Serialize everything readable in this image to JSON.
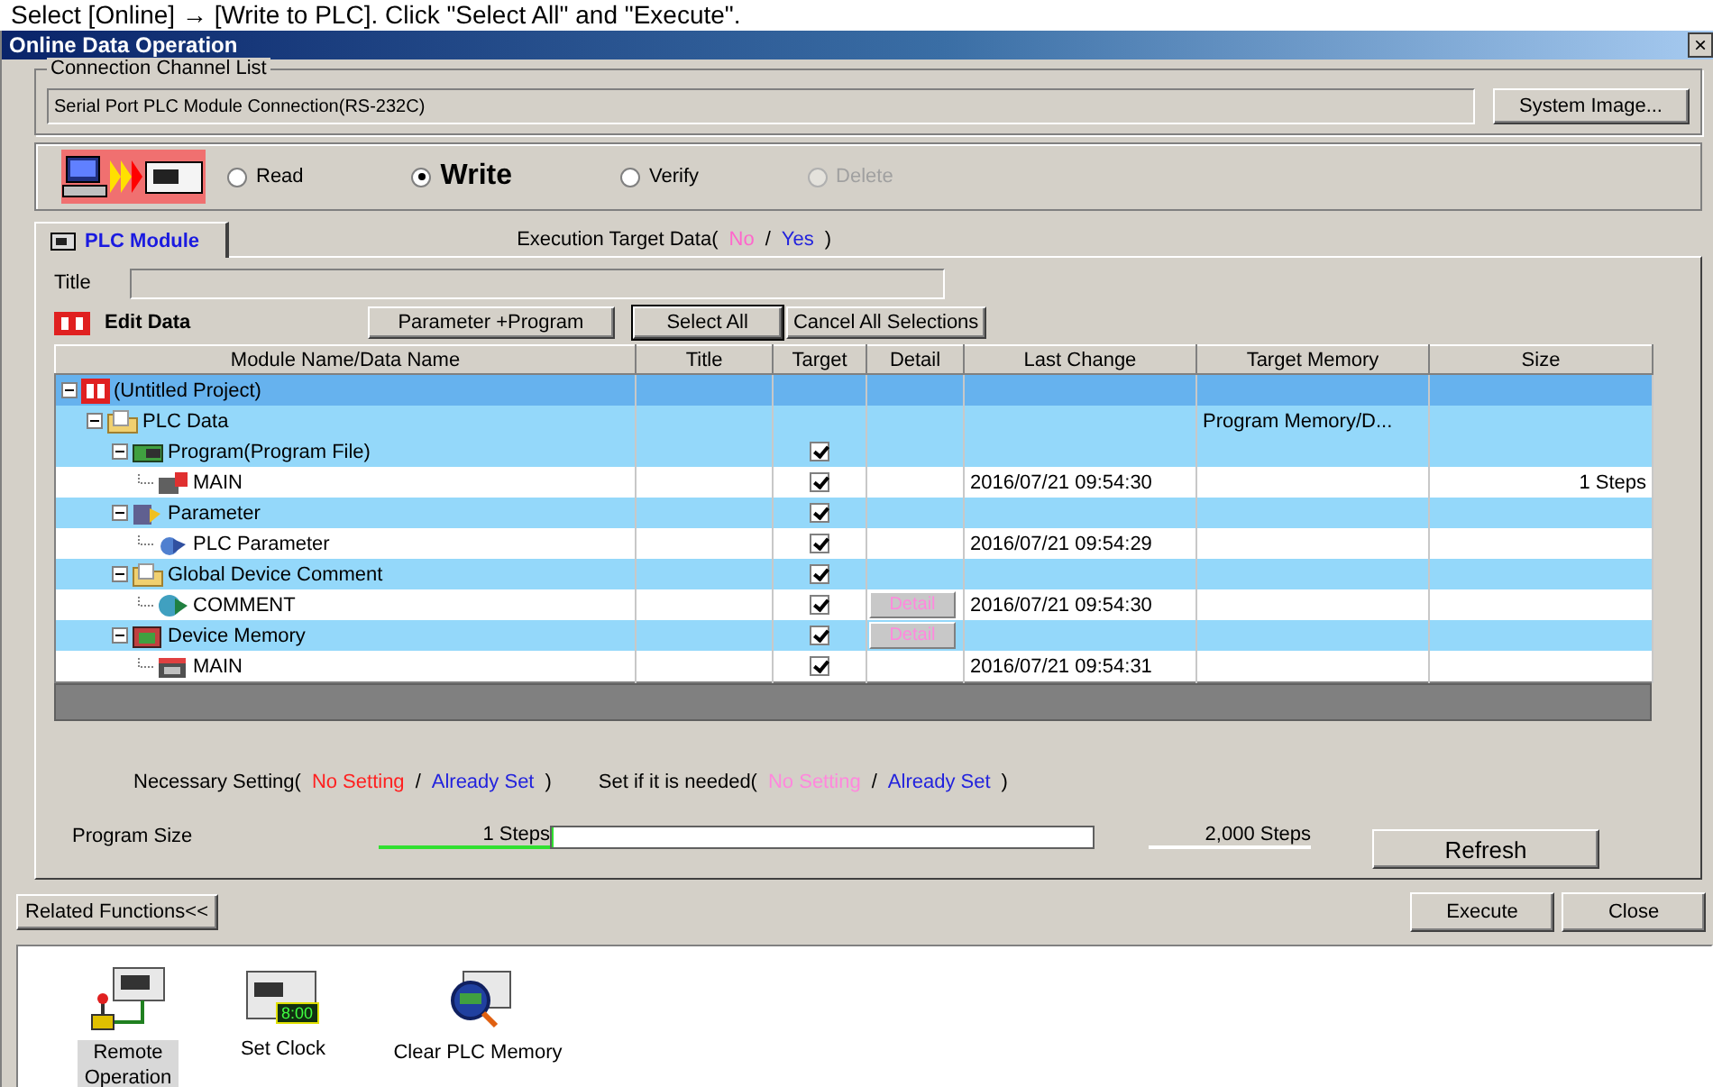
{
  "caption": "Select [Online] → [Write to PLC]. Click \"Select All\" and \"Execute\".",
  "window": {
    "title": "Online Data Operation",
    "close": "×"
  },
  "connection": {
    "legend": "Connection Channel List",
    "value": "Serial Port  PLC Module Connection(RS-232C)",
    "button": "System Image..."
  },
  "modes": [
    {
      "label": "Read",
      "selected": false,
      "disabled": false
    },
    {
      "label": "Write",
      "selected": true,
      "disabled": false
    },
    {
      "label": "Verify",
      "selected": false,
      "disabled": false
    },
    {
      "label": "Delete",
      "selected": false,
      "disabled": true
    }
  ],
  "tabs": [
    {
      "label": "PLC Module",
      "selected": true
    }
  ],
  "execution_target": [
    {
      "text": "Execution Target Data(",
      "color": "#000000"
    },
    {
      "text": "No",
      "color": "#ff66cc"
    },
    {
      "text": "/",
      "color": "#000000"
    },
    {
      "text": "Yes",
      "color": "#2222dd"
    },
    {
      "text": ")",
      "color": "#000000"
    }
  ],
  "title_field": {
    "label": "Title"
  },
  "edit_data": {
    "label": "Edit Data"
  },
  "buttons": [
    "Parameter +Program",
    "Select All",
    "Cancel All Selections"
  ],
  "table": {
    "columns": [
      "Module Name/Data Name",
      "Title",
      "Target",
      "Detail",
      "Last Change",
      "Target Memory",
      "Size"
    ],
    "rows": [
      {
        "name": "(Untitled Project)",
        "kind": "project",
        "selected": true,
        "expanded": true,
        "children": [
          {
            "name": "PLC Data",
            "kind": "folder",
            "selected": false,
            "expanded": true,
            "target_memory": "Program Memory/D...",
            "children": [
              {
                "name": "Program(Program File)",
                "kind": "program",
                "selected": false,
                "expanded": true,
                "target": true,
                "children": [
                  {
                    "name": "MAIN",
                    "kind": "program-file",
                    "selected": false,
                    "target": true,
                    "last_change": "2016/07/21 09:54:30",
                    "size": "1 Steps"
                  }
                ]
              },
              {
                "name": "Parameter",
                "kind": "parameter",
                "selected": false,
                "expanded": true,
                "target": true,
                "children": [
                  {
                    "name": "PLC Parameter",
                    "kind": "parameter-file",
                    "selected": false,
                    "target": true,
                    "last_change": "2016/07/21 09:54:29"
                  }
                ]
              },
              {
                "name": "Global Device Comment",
                "kind": "folder",
                "selected": false,
                "expanded": true,
                "target": true,
                "children": [
                  {
                    "name": "COMMENT",
                    "kind": "comment-file",
                    "selected": false,
                    "target": true,
                    "detail": "Detail",
                    "last_change": "2016/07/21 09:54:30"
                  }
                ]
              },
              {
                "name": "Device Memory",
                "kind": "memory",
                "selected": false,
                "expanded": true,
                "target": true,
                "detail": "Detail",
                "children": [
                  {
                    "name": "MAIN",
                    "kind": "memory-file",
                    "selected": false,
                    "target": true,
                    "last_change": "2016/07/21 09:54:31"
                  }
                ]
              }
            ]
          }
        ]
      }
    ]
  },
  "setting_legend": [
    {
      "text": "Necessary Setting(",
      "color": "#000000"
    },
    {
      "text": "No Setting",
      "color": "#ff2020"
    },
    {
      "text": "/",
      "color": "#000000"
    },
    {
      "text": "Already Set",
      "color": "#2222dd"
    },
    {
      "text": ")",
      "color": "#000000"
    },
    {
      "text": "Set if it is needed(",
      "color": "#000000"
    },
    {
      "text": "No Setting",
      "color": "#ff88dd"
    },
    {
      "text": "/",
      "color": "#000000"
    },
    {
      "text": "Already Set",
      "color": "#2222dd"
    },
    {
      "text": ")",
      "color": "#000000"
    }
  ],
  "program_size": {
    "label": "Program Size",
    "current": "1 Steps",
    "level": 0.0005,
    "max": "2,000 Steps",
    "button": "Refresh"
  },
  "footer_buttons": {
    "related": "Related Functions<<",
    "execute": "Execute",
    "close": "Close"
  },
  "related_functions": [
    {
      "label": "Remote Operation",
      "kind": "remote",
      "selected": true
    },
    {
      "label": "Set Clock",
      "kind": "clock",
      "selected": false,
      "display": "8:00"
    },
    {
      "label": "Clear PLC Memory",
      "kind": "clear",
      "selected": false
    }
  ]
}
